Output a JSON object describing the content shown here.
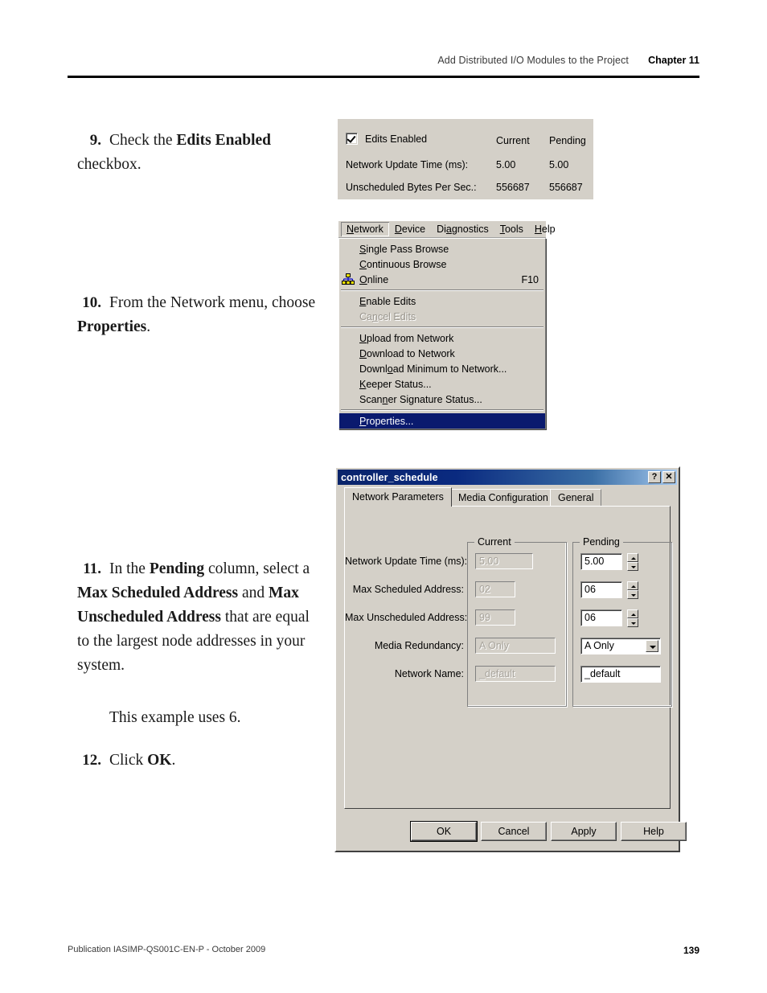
{
  "header": {
    "running_title": "Add Distributed I/O Modules to the Project",
    "chapter": "Chapter 11"
  },
  "footer": {
    "publication": "Publication IASIMP-QS001C-EN-P - October 2009",
    "page_number": "139"
  },
  "steps": [
    {
      "number": "9.",
      "text_parts": [
        {
          "t": "Check the ",
          "b": false
        },
        {
          "t": "Edits Enabled",
          "b": true
        },
        {
          "t": " checkbox.",
          "b": false
        }
      ]
    },
    {
      "number": "10.",
      "text_parts": [
        {
          "t": "From the Network menu, choose ",
          "b": false
        },
        {
          "t": "Properties",
          "b": true
        },
        {
          "t": ".",
          "b": false
        }
      ]
    },
    {
      "number": "11.",
      "text_parts": [
        {
          "t": "In the ",
          "b": false
        },
        {
          "t": "Pending",
          "b": true
        },
        {
          "t": " column, select a ",
          "b": false
        },
        {
          "t": "Max Scheduled Address",
          "b": true
        },
        {
          "t": " and ",
          "b": false
        },
        {
          "t": "Max Unscheduled Address",
          "b": true
        },
        {
          "t": " that are equal to the largest node addresses in your system.",
          "b": false
        }
      ],
      "note": "This example uses 6."
    },
    {
      "number": "12.",
      "text_parts": [
        {
          "t": "Click ",
          "b": false
        },
        {
          "t": "OK",
          "b": true
        },
        {
          "t": ".",
          "b": false
        }
      ]
    }
  ],
  "edits_panel": {
    "checkbox_label": "Edits Enabled",
    "checkbox_checked": true,
    "col_current": "Current",
    "col_pending": "Pending",
    "rows": [
      {
        "label": "Network Update Time (ms):",
        "current": "5.00",
        "pending": "5.00"
      },
      {
        "label": "Unscheduled Bytes Per Sec.:",
        "current": "556687",
        "pending": "556687"
      }
    ]
  },
  "network_menu": {
    "menubar": [
      {
        "label": "Network",
        "accel": "N",
        "active": true
      },
      {
        "label": "Device",
        "accel": "D",
        "active": false
      },
      {
        "label": "Diagnostics",
        "accel": "a",
        "active": false
      },
      {
        "label": "Tools",
        "accel": "T",
        "active": false
      },
      {
        "label": "Help",
        "accel": "H",
        "active": false
      }
    ],
    "items": [
      {
        "label": "Single Pass Browse",
        "accel_index": 0,
        "shortcut": "",
        "icon": "",
        "state": "normal",
        "separator_after": false
      },
      {
        "label": "Continuous Browse",
        "accel_index": 0,
        "shortcut": "",
        "icon": "",
        "state": "normal",
        "separator_after": false
      },
      {
        "label": "Online",
        "accel_index": 0,
        "shortcut": "F10",
        "icon": "network-tree-icon",
        "state": "normal",
        "separator_after": true
      },
      {
        "label": "Enable Edits",
        "accel_index": 0,
        "shortcut": "",
        "icon": "",
        "state": "normal",
        "separator_after": false
      },
      {
        "label": "Cancel Edits",
        "accel_index": 2,
        "shortcut": "",
        "icon": "",
        "state": "disabled",
        "separator_after": true
      },
      {
        "label": "Upload from Network",
        "accel_index": 0,
        "shortcut": "",
        "icon": "",
        "state": "normal",
        "separator_after": false
      },
      {
        "label": "Download to Network",
        "accel_index": 0,
        "shortcut": "",
        "icon": "",
        "state": "normal",
        "separator_after": false
      },
      {
        "label": "Download Minimum to Network...",
        "accel_index": 5,
        "shortcut": "",
        "icon": "",
        "state": "normal",
        "separator_after": false
      },
      {
        "label": "Keeper Status...",
        "accel_index": 0,
        "shortcut": "",
        "icon": "",
        "state": "normal",
        "separator_after": false
      },
      {
        "label": "Scanner Signature Status...",
        "accel_index": 4,
        "shortcut": "",
        "icon": "",
        "state": "normal",
        "separator_after": true
      },
      {
        "label": "Properties...",
        "accel_index": 0,
        "shortcut": "",
        "icon": "",
        "state": "selected",
        "separator_after": false
      }
    ]
  },
  "dialog": {
    "title": "controller_schedule",
    "titlebar_buttons": [
      {
        "name": "help-button",
        "glyph": "?"
      },
      {
        "name": "close-button",
        "glyph": "✕"
      }
    ],
    "tabs": [
      {
        "label": "Network Parameters",
        "selected": true
      },
      {
        "label": "Media Configuration",
        "selected": false
      },
      {
        "label": "General",
        "selected": false
      }
    ],
    "group_current": "Current",
    "group_pending": "Pending",
    "fields": [
      {
        "label": "Network Update Time (ms):",
        "current": "5.00",
        "pending": "5.00",
        "control": "spinner"
      },
      {
        "label": "Max Scheduled Address:",
        "current": "02",
        "pending": "06",
        "control": "spinner"
      },
      {
        "label": "Max Unscheduled Address:",
        "current": "99",
        "pending": "06",
        "control": "spinner"
      },
      {
        "label": "Media Redundancy:",
        "current": "A Only",
        "pending": "A Only",
        "control": "combo"
      },
      {
        "label": "Network Name:",
        "current": "_default",
        "pending": "_default",
        "control": "text"
      }
    ],
    "buttons": [
      {
        "label": "OK",
        "default": true
      },
      {
        "label": "Cancel",
        "default": false
      },
      {
        "label": "Apply",
        "default": false
      },
      {
        "label": "Help",
        "default": false
      }
    ]
  },
  "colors": {
    "window_face": "#d4d0c8",
    "menu_highlight": "#0a1a6e",
    "title_gradient_start": "#0a246a",
    "title_gradient_end": "#a6caf0",
    "disabled_text": "#9a968e"
  }
}
